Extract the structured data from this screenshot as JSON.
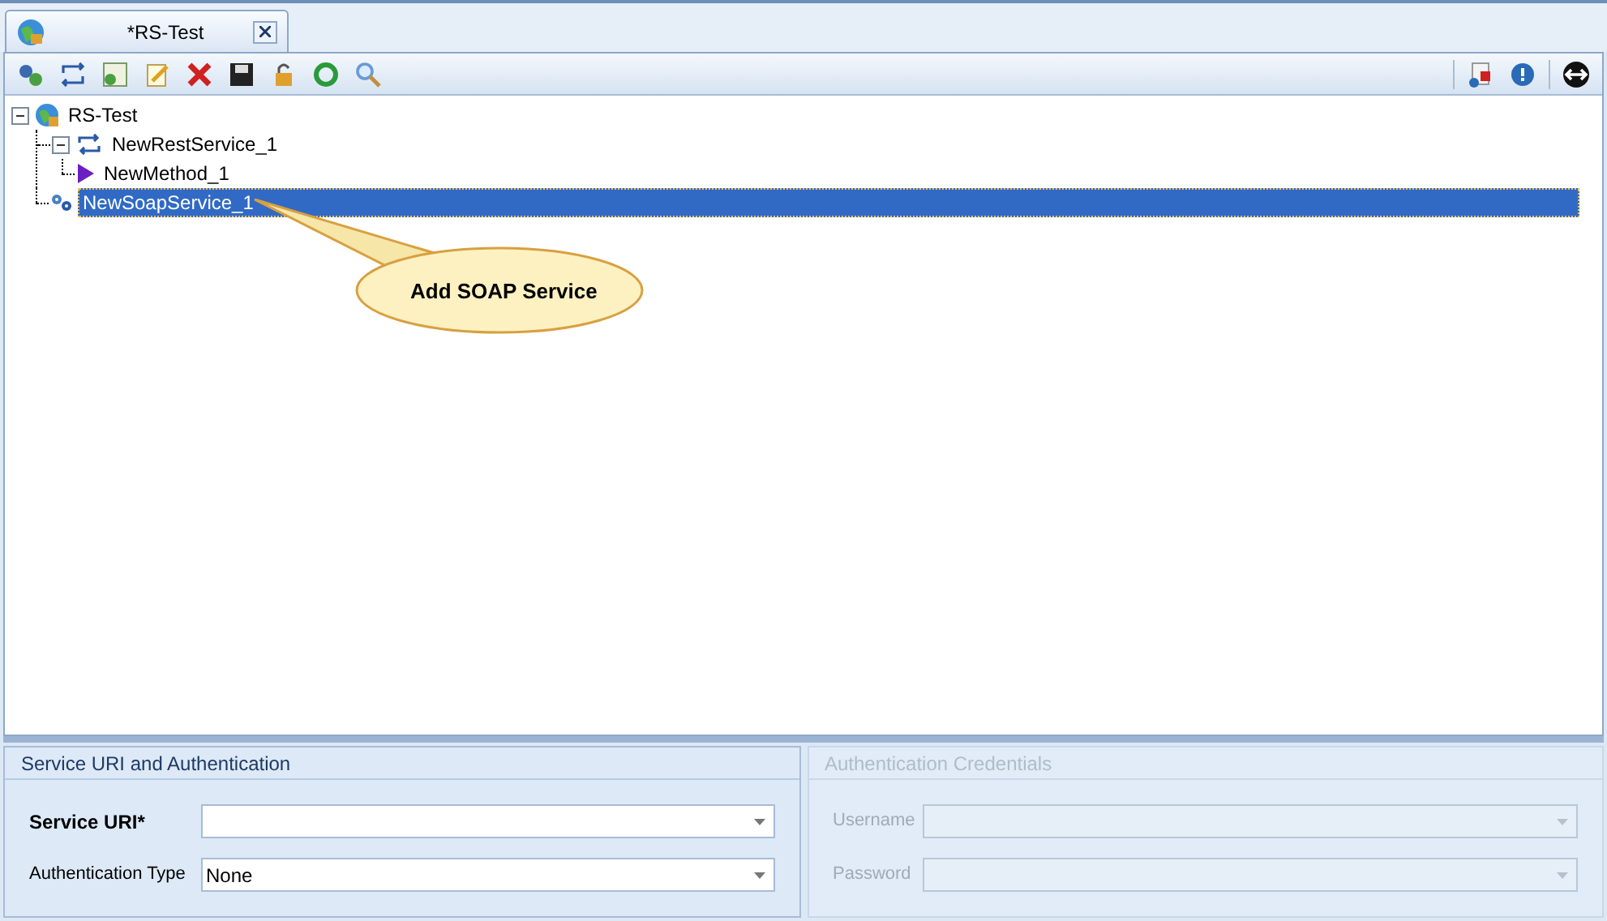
{
  "tabs": [
    {
      "label": "*RS-Test",
      "selected": true
    }
  ],
  "tree": [
    {
      "label": "RS-Test",
      "kind": "project",
      "expanded": true,
      "selected": false,
      "children": [
        {
          "label": "NewRestService_1",
          "kind": "rest",
          "expanded": true,
          "selected": false,
          "children": [
            {
              "label": "NewMethod_1",
              "kind": "method",
              "selected": false
            }
          ]
        },
        {
          "label": "NewSoapService_1",
          "kind": "soap",
          "selected": true
        }
      ]
    }
  ],
  "callout": {
    "text": "Add SOAP Service"
  },
  "panels": [
    {
      "title": "Service URI and Authentication",
      "disabled": false,
      "fields": [
        {
          "label": "Service URI*",
          "required": true
        },
        {
          "label": "Authentication Type",
          "required": false,
          "value": "None"
        }
      ]
    },
    {
      "title": "Authentication Credentials",
      "disabled": true,
      "fields": [
        {
          "label": "Username",
          "required": false
        },
        {
          "label": "Password",
          "required": false
        }
      ]
    }
  ]
}
